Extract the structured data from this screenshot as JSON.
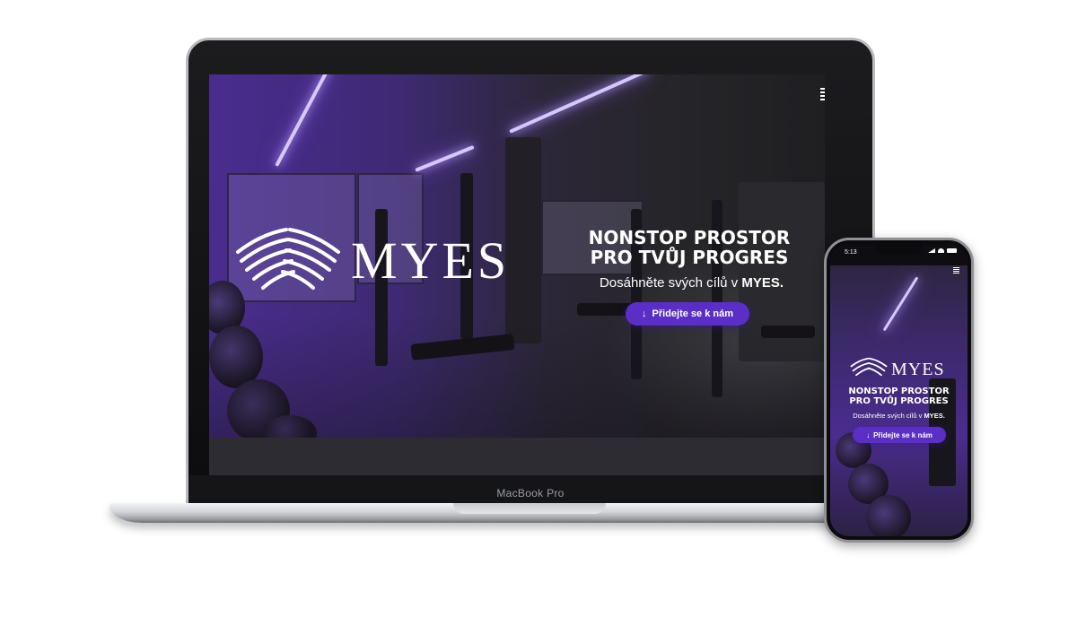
{
  "laptop": {
    "device_label": "MacBook Pro",
    "brand": "MYES",
    "headline_line1": "NONSTOP PROSTOR",
    "headline_line2": "PRO TVŮJ PROGRES",
    "subline_prefix": "Dosáhněte svých cílů v ",
    "subline_brand": "MYES.",
    "cta_label": "Přidejte se k nám",
    "icons": {
      "menu": "hamburger-menu-icon",
      "logo": "wings-icon",
      "cta": "arrow-down-icon"
    }
  },
  "phone": {
    "status_time": "5:13",
    "brand": "MYES",
    "headline_line1": "NONSTOP PROSTOR",
    "headline_line2": "PRO TVŮJ PROGRES",
    "subline_prefix": "Dosáhněte svých cílů v ",
    "subline_brand": "MYES.",
    "cta_label": "Přidejte se k nám",
    "icons": {
      "menu": "hamburger-menu-icon",
      "signal": "signal-icon",
      "wifi": "wifi-icon",
      "battery": "battery-icon"
    }
  },
  "colors": {
    "accent": "#5b2fc6",
    "purple_overlay": "#4a2c8e",
    "light_strip": "#d6c8ff",
    "text": "#ffffff"
  }
}
